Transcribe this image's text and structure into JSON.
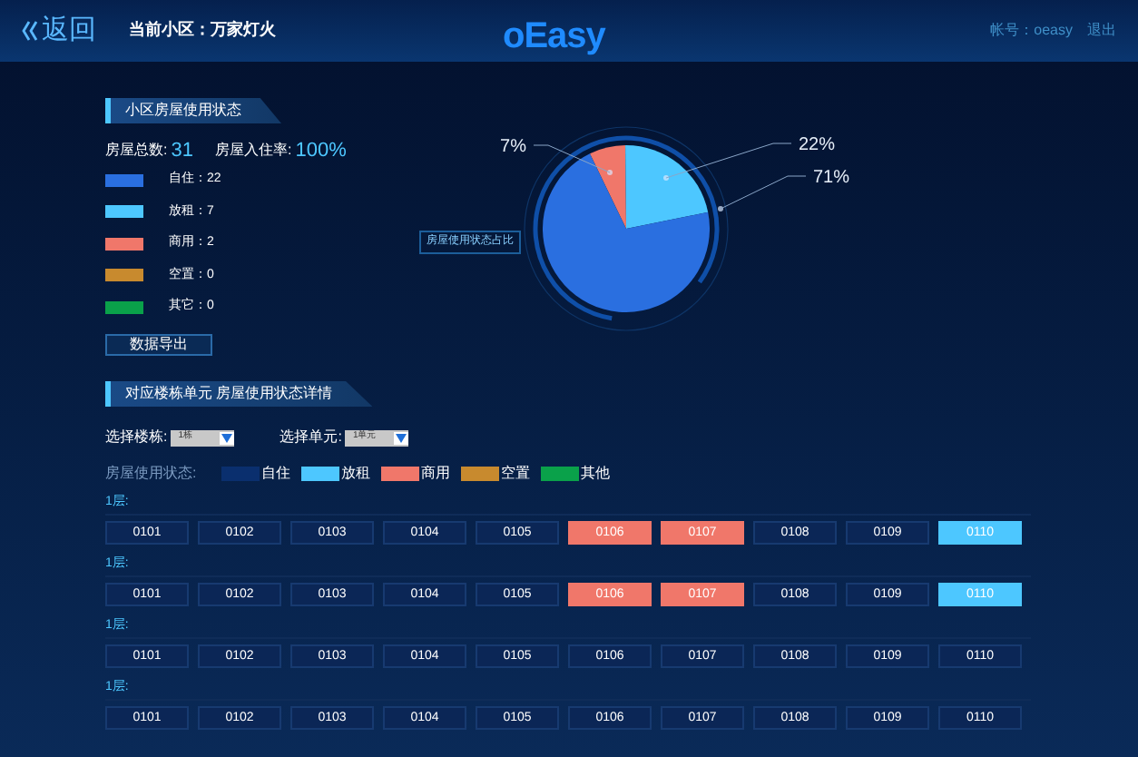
{
  "header": {
    "back": "返回",
    "community": "当前小区：万家灯火",
    "logo": "oEasy",
    "account": "帐号：oeasy",
    "logout": "退出"
  },
  "overview": {
    "title": "小区房屋使用状态",
    "total_label": "房屋总数:",
    "total": "31",
    "rate_label": "房屋入住率:",
    "rate": "100%",
    "legend": [
      {
        "text": "自住：22",
        "color": "#2a6fe0"
      },
      {
        "text": "放租：7",
        "color": "#4dc7ff"
      },
      {
        "text": "商用：2",
        "color": "#f0776a"
      },
      {
        "text": "空置：0",
        "color": "#c88a2e"
      },
      {
        "text": "其它：0",
        "color": "#0aa14a"
      }
    ],
    "export_button": "数据导出",
    "chart_label": "房屋使用状态占比",
    "chart_data": {
      "type": "pie",
      "series": [
        {
          "values": [
            71,
            22,
            7
          ]
        }
      ],
      "colors": [
        "#2a6fe0",
        "#4dc7ff",
        "#f0776a"
      ],
      "value_labels": [
        "71%",
        "22%",
        "7%"
      ]
    }
  },
  "detail": {
    "title": "对应楼栋单元 房屋使用状态详情",
    "building_label": "选择楼栋:",
    "building": "1栋",
    "unit_label": "选择单元:",
    "unit": "1单元",
    "legend_label": "房屋使用状态:",
    "legend": [
      {
        "text": "自住",
        "color": "#0a2f6e"
      },
      {
        "text": "放租",
        "color": "#4dc7ff"
      },
      {
        "text": "商用",
        "color": "#f0776a"
      },
      {
        "text": "空置",
        "color": "#c88a2e"
      },
      {
        "text": "其他",
        "color": "#0aa14a"
      }
    ],
    "floors": [
      {
        "label": "1层:",
        "rooms": [
          {
            "number": "0101",
            "kind": "self"
          },
          {
            "number": "0102",
            "kind": "self"
          },
          {
            "number": "0103",
            "kind": "self"
          },
          {
            "number": "0104",
            "kind": "self"
          },
          {
            "number": "0105",
            "kind": "self"
          },
          {
            "number": "0106",
            "kind": "commercial"
          },
          {
            "number": "0107",
            "kind": "commercial"
          },
          {
            "number": "0108",
            "kind": "self"
          },
          {
            "number": "0109",
            "kind": "self"
          },
          {
            "number": "0110",
            "kind": "rent"
          }
        ]
      },
      {
        "label": "1层:",
        "rooms": [
          {
            "number": "0101",
            "kind": "self"
          },
          {
            "number": "0102",
            "kind": "self"
          },
          {
            "number": "0103",
            "kind": "self"
          },
          {
            "number": "0104",
            "kind": "self"
          },
          {
            "number": "0105",
            "kind": "self"
          },
          {
            "number": "0106",
            "kind": "commercial"
          },
          {
            "number": "0107",
            "kind": "commercial"
          },
          {
            "number": "0108",
            "kind": "self"
          },
          {
            "number": "0109",
            "kind": "self"
          },
          {
            "number": "0110",
            "kind": "rent"
          }
        ]
      },
      {
        "label": "1层:",
        "rooms": [
          {
            "number": "0101",
            "kind": "self"
          },
          {
            "number": "0102",
            "kind": "self"
          },
          {
            "number": "0103",
            "kind": "self"
          },
          {
            "number": "0104",
            "kind": "self"
          },
          {
            "number": "0105",
            "kind": "self"
          },
          {
            "number": "0106",
            "kind": "self"
          },
          {
            "number": "0107",
            "kind": "self"
          },
          {
            "number": "0108",
            "kind": "self"
          },
          {
            "number": "0109",
            "kind": "self"
          },
          {
            "number": "0110",
            "kind": "self"
          }
        ]
      },
      {
        "label": "1层:",
        "rooms": [
          {
            "number": "0101",
            "kind": "self"
          },
          {
            "number": "0102",
            "kind": "self"
          },
          {
            "number": "0103",
            "kind": "self"
          },
          {
            "number": "0104",
            "kind": "self"
          },
          {
            "number": "0105",
            "kind": "self"
          },
          {
            "number": "0106",
            "kind": "self"
          },
          {
            "number": "0107",
            "kind": "self"
          },
          {
            "number": "0108",
            "kind": "self"
          },
          {
            "number": "0109",
            "kind": "self"
          },
          {
            "number": "0110",
            "kind": "self"
          }
        ]
      }
    ]
  }
}
